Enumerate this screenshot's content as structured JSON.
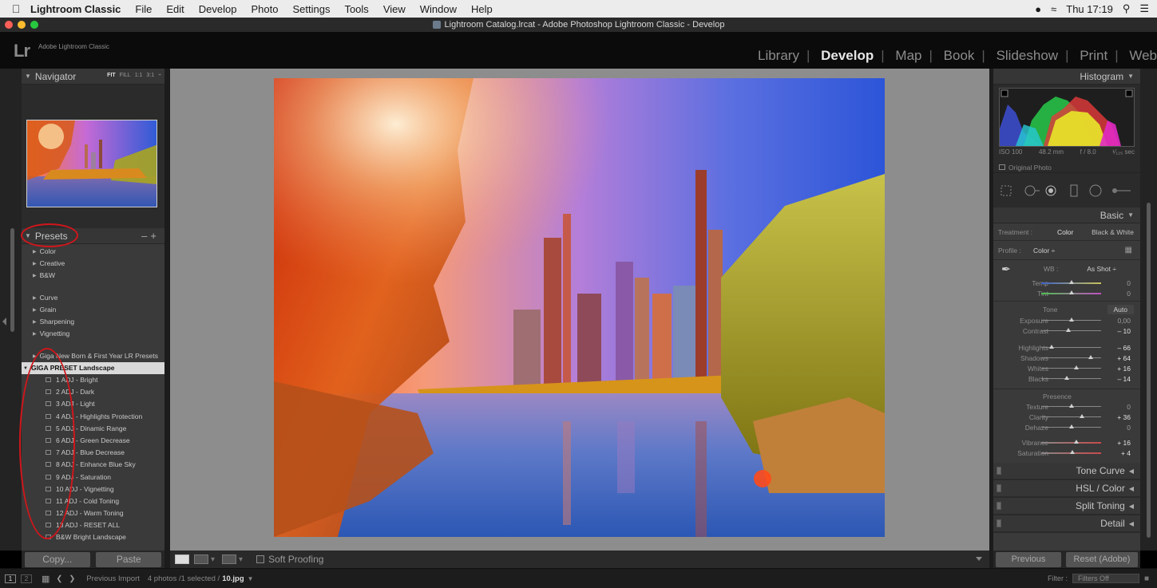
{
  "menubar": {
    "apple": "",
    "app_name": "Lightroom Classic",
    "items": [
      "File",
      "Edit",
      "Develop",
      "Photo",
      "Settings",
      "Tools",
      "View",
      "Window",
      "Help"
    ],
    "clock": "Thu 17:19"
  },
  "window": {
    "title": "Lightroom Catalog.lrcat - Adobe Photoshop Lightroom Classic - Develop"
  },
  "identity": {
    "logo": "Lr",
    "name": "Adobe Lightroom Classic"
  },
  "modules": [
    "Library",
    "Develop",
    "Map",
    "Book",
    "Slideshow",
    "Print",
    "Web"
  ],
  "active_module": "Develop",
  "navigator": {
    "title": "Navigator",
    "zoom_options": [
      "FIT",
      "FILL",
      "1:1",
      "3:1",
      "÷"
    ]
  },
  "presets": {
    "title": "Presets",
    "groups_top": [
      "Color",
      "Creative",
      "B&W"
    ],
    "groups_mid": [
      "Curve",
      "Grain",
      "Sharpening",
      "Vignetting"
    ],
    "group_giga_newborn": "Giga New Born & First Year LR Presets",
    "group_open": "GIGA PRESET Landscape",
    "items": [
      "1 ADJ - Bright",
      "2 ADJ - Dark",
      "3 ADJ - Light",
      "4 ADJ - Highlights Protection",
      "5 ADJ - Dinamic Range",
      "6 ADJ - Green Decrease",
      "7 ADJ - Blue Decrease",
      "8 ADJ - Enhance Blue Sky",
      "9 ADJ - Saturation",
      "10 ADJ - Vignetting",
      "11 ADJ - Cold Toning",
      "12 ADJ - Warm Toning",
      "13 ADJ - RESET ALL",
      "B&W Bright Landscape"
    ]
  },
  "left_buttons": {
    "copy": "Copy...",
    "paste": "Paste"
  },
  "toolbar": {
    "soft_proofing": "Soft Proofing"
  },
  "histogram": {
    "title": "Histogram",
    "iso": "ISO 100",
    "focal": "48.2 mm",
    "aperture": "f / 8.0",
    "shutter": "¹⁄₁₂₅ sec",
    "original_photo": "Original Photo"
  },
  "basic": {
    "title": "Basic",
    "treatment_label": "Treatment :",
    "treatment_color": "Color",
    "treatment_bw": "Black & White",
    "profile_label": "Profile :",
    "profile_value": "Color ÷",
    "wb_label": "WB :",
    "wb_value": "As Shot ÷",
    "tone_label": "Tone",
    "auto_label": "Auto",
    "presence_label": "Presence",
    "sliders": [
      {
        "label": "Temp",
        "value": "0",
        "pos": 0.5
      },
      {
        "label": "Tint",
        "value": "0",
        "pos": 0.5
      },
      {
        "label": "Exposure",
        "value": "0,00",
        "pos": 0.5
      },
      {
        "label": "Contrast",
        "value": "– 10",
        "pos": 0.45
      },
      {
        "label": "Highlights",
        "value": "– 66",
        "pos": 0.17
      },
      {
        "label": "Shadows",
        "value": "+ 64",
        "pos": 0.82
      },
      {
        "label": "Whites",
        "value": "+ 16",
        "pos": 0.58
      },
      {
        "label": "Blacks",
        "value": "– 14",
        "pos": 0.43
      },
      {
        "label": "Texture",
        "value": "0",
        "pos": 0.5
      },
      {
        "label": "Clarity",
        "value": "+ 36",
        "pos": 0.68
      },
      {
        "label": "Dehaze",
        "value": "0",
        "pos": 0.5
      },
      {
        "label": "Vibrance",
        "value": "+ 16",
        "pos": 0.58
      },
      {
        "label": "Saturation",
        "value": "+ 4",
        "pos": 0.52
      }
    ]
  },
  "collapsed_panels": [
    {
      "label": "Tone Curve"
    },
    {
      "label": "HSL / Color"
    },
    {
      "label": "Split Toning"
    },
    {
      "label": "Detail"
    }
  ],
  "right_buttons": {
    "previous": "Previous",
    "reset": "Reset (Adobe)"
  },
  "filmstrip": {
    "page1": "1",
    "page2": "2",
    "source": "Previous Import",
    "count": "4 photos /1 selected /",
    "file": "10.jpg",
    "filter_label": "Filter :",
    "filter_value": "Filters Off"
  },
  "colors": {
    "accent_red_annotation": "#d0161b",
    "panel_bg": "#3a3a3a",
    "center_bg": "#8d8d8d"
  }
}
